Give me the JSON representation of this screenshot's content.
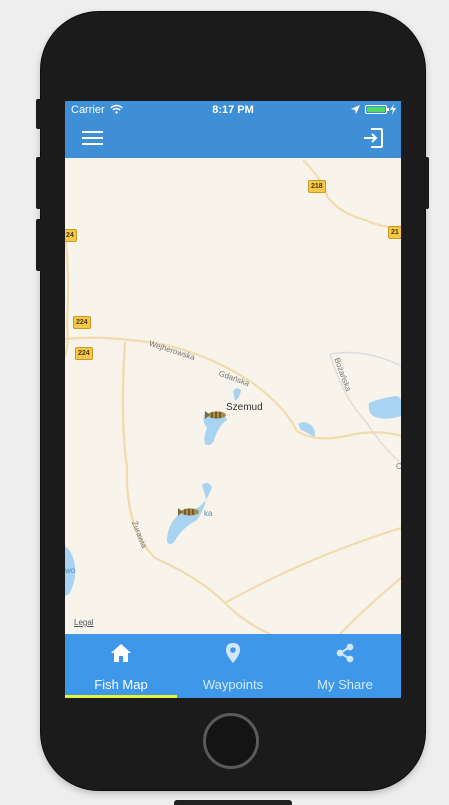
{
  "status_bar": {
    "carrier": "Carrier",
    "time": "8:17 PM",
    "wifi_icon": "wifi-icon",
    "location_icon": "location-arrow-icon",
    "battery_icon": "battery-charging-icon"
  },
  "nav_bar": {
    "menu_icon": "hamburger-menu-icon",
    "logout_icon": "sign-out-icon",
    "color": "#3e8fd5"
  },
  "map": {
    "town_label": "Szemud",
    "street_labels": {
      "wejherowska": "Wejherowska",
      "gdanska": "Gdańska",
      "bozanska": "Bożańska",
      "zurawia": "Żurawia",
      "lake_south": "ka",
      "lake_west": "wo",
      "east_o": "O"
    },
    "road_shields": {
      "r218": "218",
      "r224_top": "24",
      "r224_a": "224",
      "r224_b": "224",
      "r21": "21"
    },
    "legal_link": "Legal",
    "marker_icon": "fish-marker-icon"
  },
  "tab_bar": {
    "color": "#3e97e8",
    "active_indicator_color": "#e8f23a",
    "tabs": [
      {
        "label": "Fish Map",
        "icon": "home-icon",
        "active": true
      },
      {
        "label": "Waypoints",
        "icon": "map-pin-icon",
        "active": false
      },
      {
        "label": "My Share",
        "icon": "share-icon",
        "active": false
      }
    ]
  }
}
